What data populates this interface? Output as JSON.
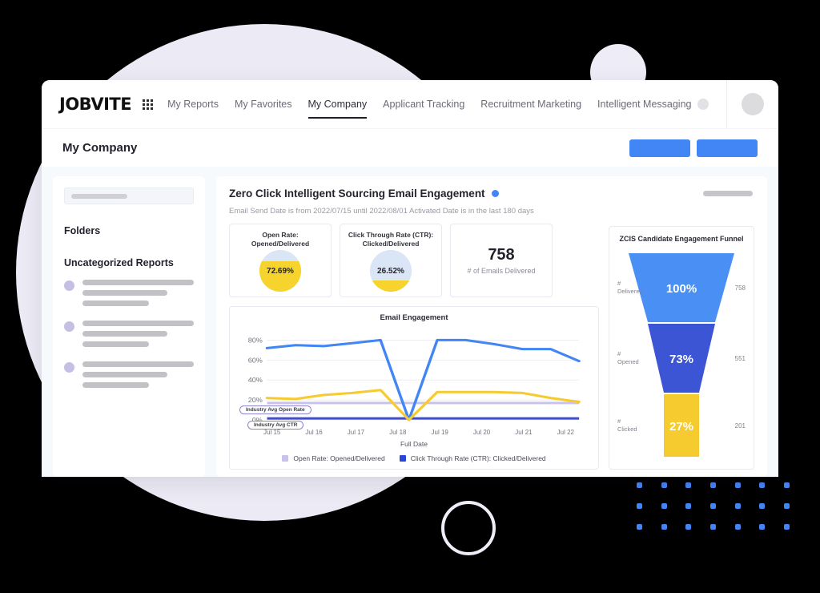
{
  "brand": {
    "logo": "JOBVITE",
    "accent": "#4285f4"
  },
  "nav": {
    "items": [
      {
        "label": "My Reports",
        "active": false
      },
      {
        "label": "My Favorites",
        "active": false
      },
      {
        "label": "My Company",
        "active": true
      },
      {
        "label": "Applicant Tracking",
        "active": false
      },
      {
        "label": "Recruitment Marketing",
        "active": false
      },
      {
        "label": "Intelligent Messaging",
        "active": false
      }
    ]
  },
  "page": {
    "title": "My Company"
  },
  "sidebar": {
    "search_placeholder": "",
    "headings": {
      "folders": "Folders",
      "uncategorized": "Uncategorized Reports"
    },
    "report_count": 3
  },
  "report": {
    "title": "Zero Click Intelligent Sourcing Email Engagement",
    "filters": "Email Send Date is from 2022/07/15 until 2022/08/01   Activated Date is in the last 180 days",
    "kpis": [
      {
        "caption": "Open Rate:\nOpened/Delivered",
        "value": "72.69%",
        "pct": 72.69
      },
      {
        "caption": "Click Through Rate (CTR):\nClicked/Delivered",
        "value": "26.52%",
        "pct": 26.52
      }
    ],
    "counter": {
      "value": "758",
      "label": "# of Emails Delivered"
    }
  },
  "chart_data": [
    {
      "type": "line",
      "title": "Email Engagement",
      "xlabel": "Full Date",
      "ylabel": "",
      "ylim": [
        0,
        90
      ],
      "yticks": [
        "0%",
        "20%",
        "40%",
        "60%",
        "80%"
      ],
      "ytick_values": [
        0,
        20,
        40,
        60,
        80
      ],
      "categories": [
        "Jul 15",
        "Jul 16",
        "Jul 17",
        "Jul 18",
        "Jul 19",
        "Jul 20",
        "Jul 21",
        "Jul 22"
      ],
      "x": [
        0,
        1,
        2,
        3,
        4,
        5,
        6,
        7,
        8,
        9,
        10
      ],
      "grid": true,
      "legend_position": "bottom",
      "series": [
        {
          "name": "Open Rate: Opened/Delivered",
          "color": "#4285f4",
          "values": [
            72,
            75,
            74,
            77,
            80,
            0,
            80,
            80,
            76,
            71,
            71,
            59
          ]
        },
        {
          "name": "Click Through Rate (CTR): Clicked/Delivered",
          "color": "#f6cb2f",
          "values": [
            22,
            21,
            25,
            27,
            30,
            0,
            28,
            28,
            28,
            27,
            22,
            18
          ]
        }
      ],
      "reference_lines": [
        {
          "label": "Industry Avg Open Rate",
          "value": 17,
          "color": "#c9c2ee"
        },
        {
          "label": "Industry Avg CTR",
          "value": 1.5,
          "color": "#3d4fd0"
        }
      ],
      "legend": [
        {
          "label": "Open Rate: Opened/Delivered",
          "color": "#c9c2ee"
        },
        {
          "label": "Click Through Rate (CTR): Clicked/Delivered",
          "color": "#2a46d8"
        }
      ]
    },
    {
      "type": "funnel",
      "title": "ZCIS Candidate Engagement Funnel",
      "stages": [
        {
          "label": "#\nDelivered",
          "percent": "100%",
          "count": "758",
          "color": "#4a90f4",
          "pct_value": 100
        },
        {
          "label": "#\nOpened",
          "percent": "73%",
          "count": "551",
          "color": "#3c55d4",
          "pct_value": 73
        },
        {
          "label": "#\nClicked",
          "percent": "27%",
          "count": "201",
          "color": "#f6cb2f",
          "pct_value": 27
        }
      ]
    }
  ]
}
